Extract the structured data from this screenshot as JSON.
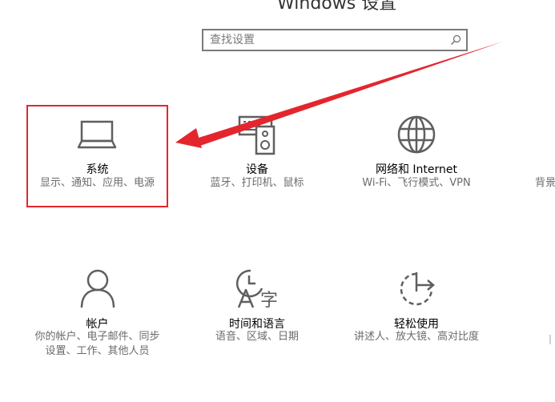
{
  "window": {
    "title": "Windows 设置"
  },
  "search": {
    "placeholder": "查找设置",
    "icon": "search-icon"
  },
  "tiles": [
    {
      "id": "system",
      "name": "系统",
      "desc": [
        "显示、通知、应用、电源"
      ],
      "icon": "laptop-icon"
    },
    {
      "id": "devices",
      "name": "设备",
      "desc": [
        "蓝牙、打印机、鼠标"
      ],
      "icon": "devices-icon"
    },
    {
      "id": "network",
      "name": "网络和 Internet",
      "desc": [
        "Wi-Fi、飞行模式、VPN"
      ],
      "icon": "globe-icon"
    },
    {
      "id": "personalization",
      "name": "",
      "desc": [
        "背景"
      ],
      "icon": ""
    },
    {
      "id": "accounts",
      "name": "帐户",
      "desc": [
        "你的帐户、电子邮件、同步",
        "设置、工作、其他人员"
      ],
      "icon": "person-icon"
    },
    {
      "id": "time-language",
      "name": "时间和语言",
      "desc": [
        "语音、区域、日期"
      ],
      "icon": "time-language-icon"
    },
    {
      "id": "ease-of-access",
      "name": "轻松使用",
      "desc": [
        "讲述人、放大镜、高对比度"
      ],
      "icon": "ease-of-access-icon"
    }
  ],
  "annotation": {
    "highlight_color": "#e3262d"
  },
  "colors": {
    "icon": "#5f5f5f",
    "desc": "#6b6b6b",
    "border": "#7a7a7a"
  }
}
